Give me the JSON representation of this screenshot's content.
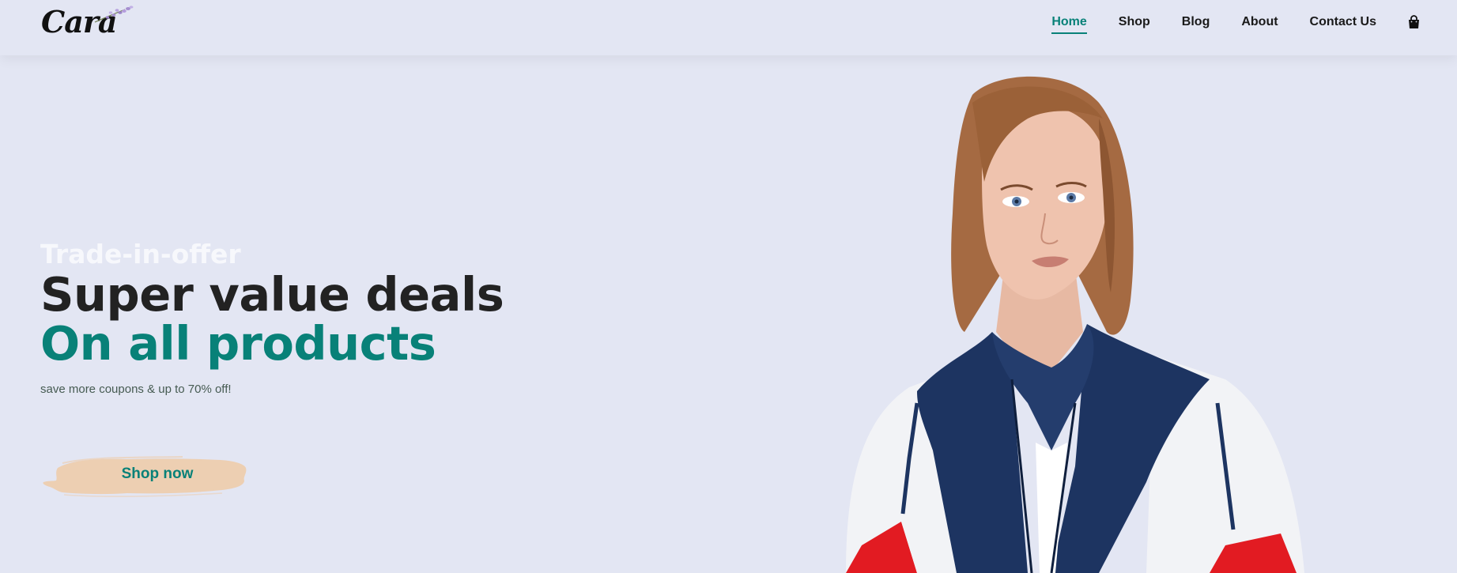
{
  "brand": {
    "logo_text": "Cara",
    "logo_icon": "lavender-sprig-icon"
  },
  "nav": {
    "items": [
      {
        "label": "Home",
        "active": true
      },
      {
        "label": "Shop",
        "active": false
      },
      {
        "label": "Blog",
        "active": false
      },
      {
        "label": "About",
        "active": false
      },
      {
        "label": "Contact Us",
        "active": false
      }
    ],
    "cart_icon": "shopping-bag-icon"
  },
  "hero": {
    "eyebrow": "Trade-in-offer",
    "headline_line1": "Super value deals",
    "headline_line2": "On all products",
    "subtext": "save more coupons & up to 70% off!",
    "cta_label": "Shop now",
    "image": "model-in-windbreaker-photo"
  },
  "colors": {
    "background": "#e3e6f3",
    "accent": "#088178",
    "dark_text": "#222222",
    "cta_brush": "#edcfb2",
    "eyebrow": "#f7f8fc"
  }
}
